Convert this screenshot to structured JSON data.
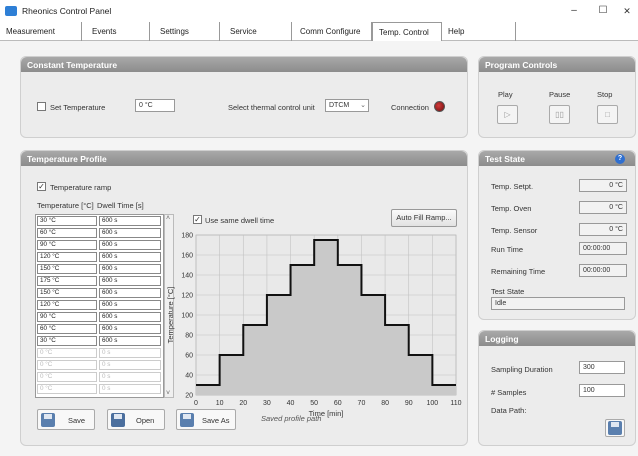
{
  "window": {
    "title": "Rheonics Control Panel",
    "minimize": "–",
    "maximize": "☐",
    "close": "✕"
  },
  "tabs": [
    "Measurement",
    "Events",
    "Settings",
    "Service",
    "Comm Configure",
    "Temp. Control",
    "Help"
  ],
  "constant_temperature": {
    "title": "Constant Temperature",
    "set_temperature_label": "Set Temperature",
    "temperature_value": "0 °C",
    "unit_label": "Select thermal control unit",
    "unit_value": "DTCM",
    "connection_label": "Connection"
  },
  "program_controls": {
    "title": "Program Controls",
    "play": "Play",
    "pause": "Pause",
    "stop": "Stop"
  },
  "temperature_profile": {
    "title": "Temperature Profile",
    "ramp_label": "Temperature ramp",
    "col_temp": "Temperature [°C]",
    "col_dwell": "Dwell Time [s]",
    "rows": [
      {
        "t": "30 °C",
        "d": "600 s"
      },
      {
        "t": "60 °C",
        "d": "600 s"
      },
      {
        "t": "90 °C",
        "d": "600 s"
      },
      {
        "t": "120 °C",
        "d": "600 s"
      },
      {
        "t": "150 °C",
        "d": "600 s"
      },
      {
        "t": "175 °C",
        "d": "600 s"
      },
      {
        "t": "150 °C",
        "d": "600 s"
      },
      {
        "t": "120 °C",
        "d": "600 s"
      },
      {
        "t": "90 °C",
        "d": "600 s"
      },
      {
        "t": "60 °C",
        "d": "600 s"
      },
      {
        "t": "30 °C",
        "d": "600 s"
      },
      {
        "t": "0 °C",
        "d": "0 s"
      },
      {
        "t": "0 °C",
        "d": "0 s"
      },
      {
        "t": "0 °C",
        "d": "0 s"
      },
      {
        "t": "0 °C",
        "d": "0 s"
      }
    ],
    "same_dwell_label": "Use same dwell time",
    "auto_fill_label": "Auto Fill Ramp...",
    "save_label": "Save",
    "open_label": "Open",
    "save_as_label": "Save As",
    "saved_path_label": "Saved profile path"
  },
  "test_state": {
    "title": "Test State",
    "info_icon": "?",
    "setpt_label": "Temp. Setpt.",
    "setpt_value": "0 °C",
    "oven_label": "Temp. Oven",
    "oven_value": "0 °C",
    "sensor_label": "Temp. Sensor",
    "sensor_value": "0 °C",
    "run_label": "Run Time",
    "run_value": "00:00:00",
    "remaining_label": "Remaining Time",
    "remaining_value": "00:00:00",
    "state_label": "Test State",
    "state_value": "Idle"
  },
  "logging": {
    "title": "Logging",
    "duration_label": "Sampling Duration",
    "duration_value": "300",
    "samples_label": "# Samples",
    "samples_value": "100",
    "path_label": "Data Path:"
  },
  "chart_data": {
    "type": "line",
    "xlabel": "Time [min]",
    "ylabel": "Temperature [°C]",
    "xlim": [
      0,
      110
    ],
    "ylim": [
      20,
      180
    ],
    "xticks": [
      0,
      10,
      20,
      30,
      40,
      50,
      60,
      70,
      80,
      90,
      100,
      110
    ],
    "yticks": [
      20,
      40,
      60,
      80,
      100,
      120,
      140,
      160,
      180
    ],
    "x": [
      0,
      10,
      10,
      20,
      20,
      30,
      30,
      40,
      40,
      50,
      50,
      60,
      60,
      70,
      70,
      80,
      80,
      90,
      90,
      100,
      100,
      110
    ],
    "y": [
      30,
      30,
      60,
      60,
      90,
      90,
      120,
      120,
      150,
      150,
      175,
      175,
      150,
      150,
      120,
      120,
      90,
      90,
      60,
      60,
      30,
      30
    ],
    "grid": true
  }
}
